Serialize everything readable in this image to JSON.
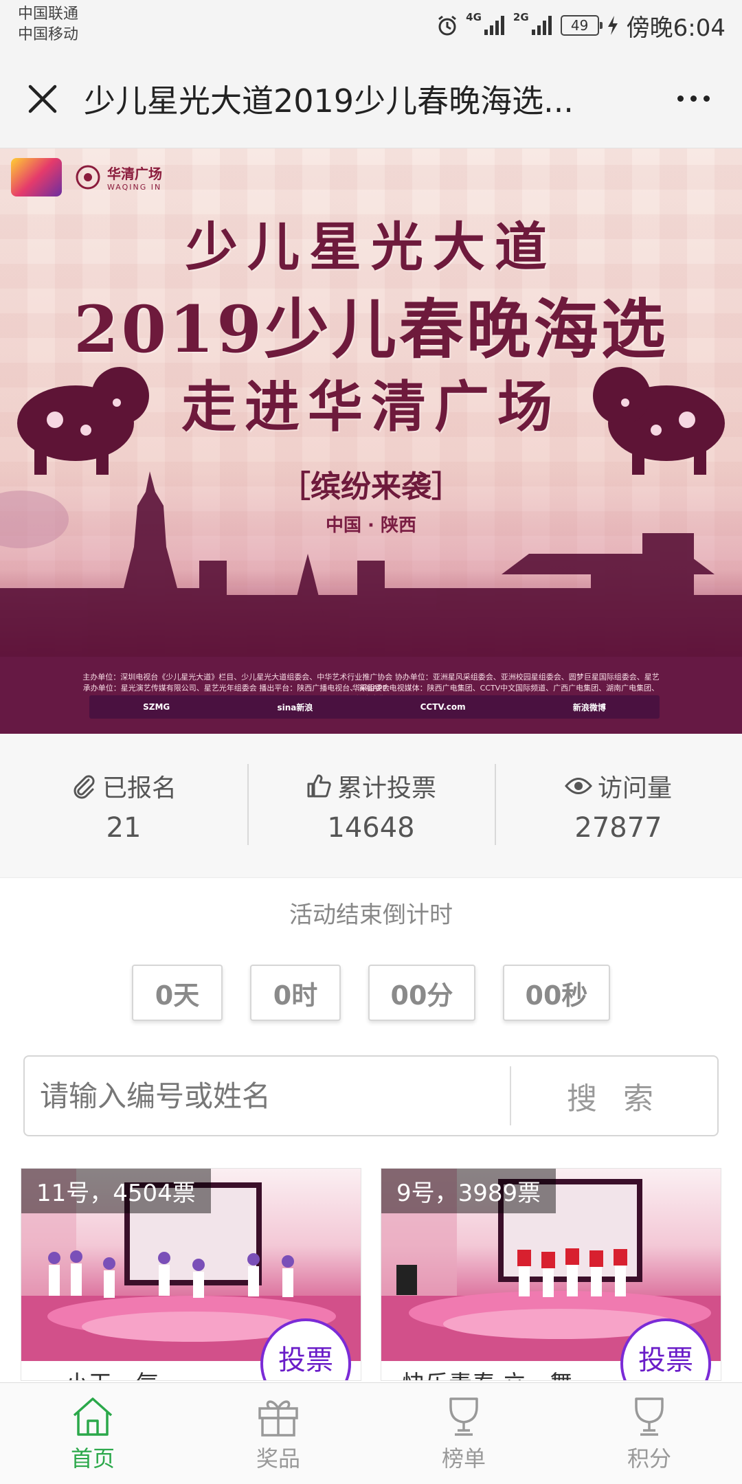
{
  "status_bar": {
    "carrier1": "中国联通",
    "carrier2": "中国移动",
    "signal1_label": "4G",
    "signal2_label": "2G",
    "battery": "49",
    "time": "傍晚6:04"
  },
  "titlebar": {
    "title": "少儿星光大道2019少儿春晚海选..."
  },
  "banner": {
    "logo_text": "华清广场",
    "logo_sub": "WAQING IN",
    "line1": "少儿星光大道",
    "line2": "2019少儿春晚海选",
    "line3": "走进华清广场",
    "tag": "［缤纷来袭］",
    "location": "中国 · 陕西",
    "organizers": "主办单位：深圳电视台《少儿星光大道》栏目、少儿星光大道组委会、中华艺术行业推广协会  协办单位：亚洲星风采组委会、亚洲校园星组委会、圆梦巨星国际组委会、星艺华采组委会",
    "organizers2": "承办单位：星光演艺传媒有限公司、星艺光年组委会  播出平台：陕西广播电视台、演唱APP  电视媒体：陕西广电集团、CCTV中文国际频道、广西广电集团、湖南广电集团、深圳广电集团",
    "sponsors": [
      "SZMG",
      "sina新浪",
      "CCTV.com",
      "新浪微博"
    ]
  },
  "stats": {
    "registered_label": "已报名",
    "registered_value": "21",
    "votes_label": "累计投票",
    "votes_value": "14648",
    "visits_label": "访问量",
    "visits_value": "27877"
  },
  "countdown": {
    "title": "活动结束倒计时",
    "days": "0天",
    "hours": "0时",
    "minutes": "00分",
    "seconds": "00秒"
  },
  "search": {
    "placeholder": "请输入编号或姓名",
    "button": "搜 索"
  },
  "cards": [
    {
      "label": "11号，4504票",
      "name": "…小天…气…",
      "vote": "投票"
    },
    {
      "label": "9号，3989票",
      "name": "快乐青春 立…舞…",
      "vote": "投票"
    }
  ],
  "bottom_nav": {
    "home": "首页",
    "prizes": "奖品",
    "ranking": "榜单",
    "points": "积分",
    "active_color": "#2ba84a"
  }
}
